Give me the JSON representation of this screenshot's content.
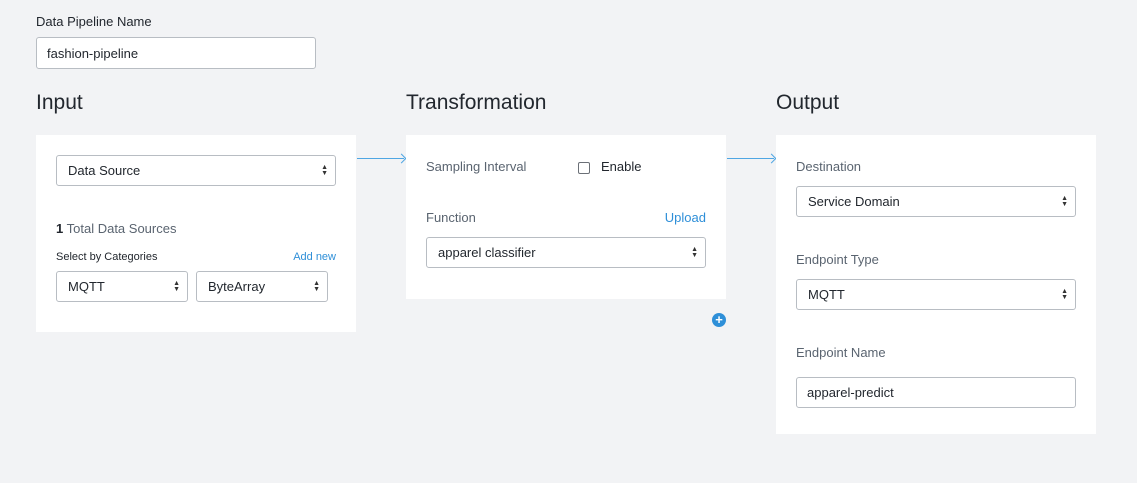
{
  "pipeline": {
    "name_label": "Data Pipeline Name",
    "name_value": "fashion-pipeline"
  },
  "input": {
    "title": "Input",
    "data_source_select": "Data Source",
    "total_count": "1",
    "total_label": "Total Data Sources",
    "select_by_categories": "Select by Categories",
    "add_new": "Add new",
    "category_select_1": "MQTT",
    "category_select_2": "ByteArray"
  },
  "transformation": {
    "title": "Transformation",
    "sampling_interval_label": "Sampling Interval",
    "enable_label": "Enable",
    "function_label": "Function",
    "upload_link": "Upload",
    "function_select": "apparel classifier",
    "add_icon": "plus-icon"
  },
  "output": {
    "title": "Output",
    "destination_label": "Destination",
    "destination_select": "Service Domain",
    "endpoint_type_label": "Endpoint Type",
    "endpoint_type_select": "MQTT",
    "endpoint_name_label": "Endpoint Name",
    "endpoint_name_value": "apparel-predict"
  },
  "colors": {
    "background": "#f2f3f5",
    "card": "#ffffff",
    "accent": "#2e8fd8",
    "arrow": "#4fa6e3"
  }
}
